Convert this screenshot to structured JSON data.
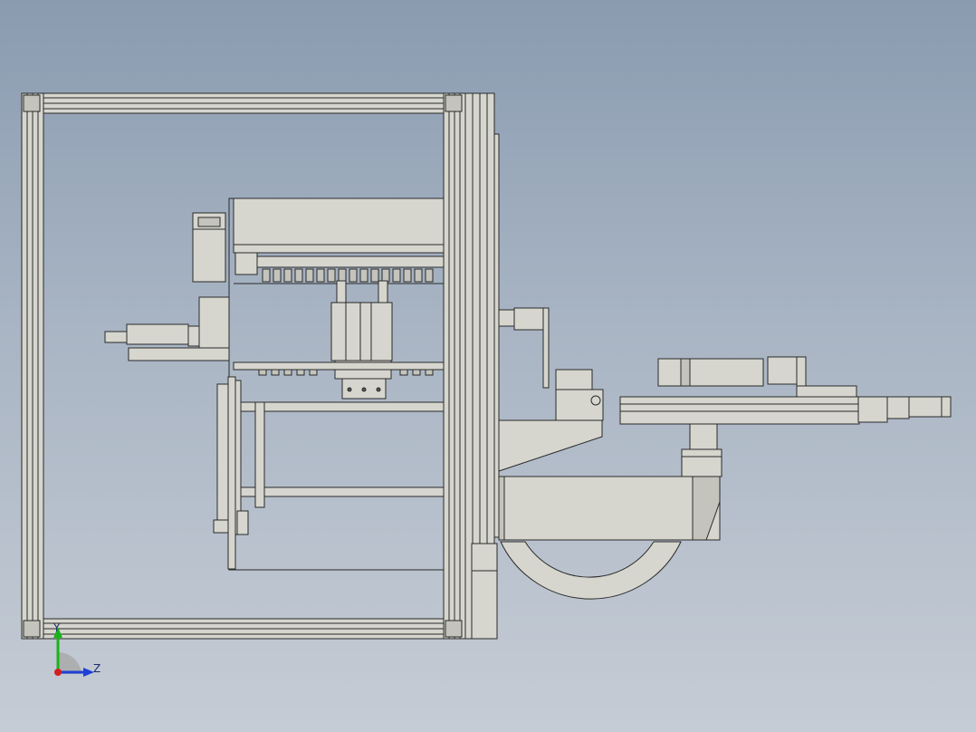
{
  "viewport": {
    "background_top": "#8a9bb0",
    "background_bottom": "#c6ccd5",
    "part_fill": "#d6d6cf",
    "part_stroke": "#2a2a2a"
  },
  "triad": {
    "y_label": "Y",
    "z_label": "Z",
    "y_color": "#19b319",
    "z_color": "#1f3fd6",
    "x_color": "#d41f1f"
  }
}
